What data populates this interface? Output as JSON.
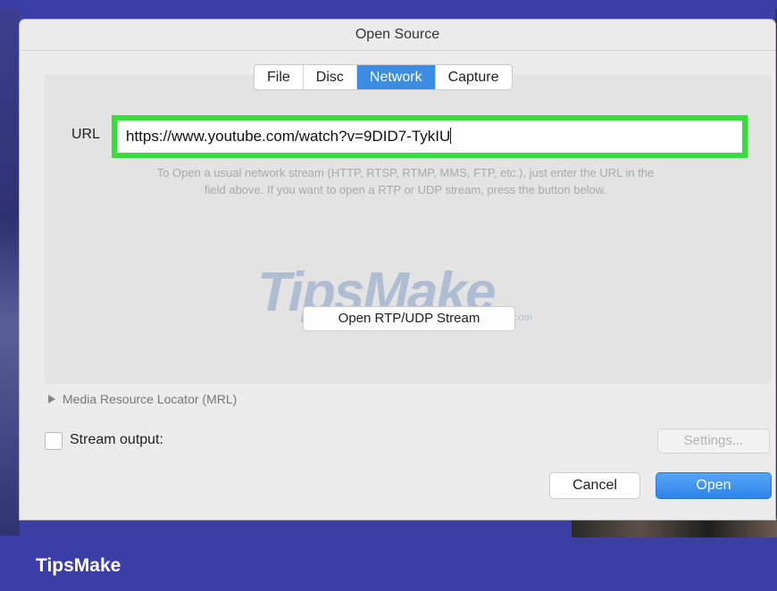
{
  "window": {
    "title": "Open Source"
  },
  "tabs": [
    {
      "label": "File",
      "active": false
    },
    {
      "label": "Disc",
      "active": false
    },
    {
      "label": "Network",
      "active": true
    },
    {
      "label": "Capture",
      "active": false
    }
  ],
  "network": {
    "url_label": "URL",
    "url_value": "https://www.youtube.com/watch?v=9DID7-TykIU",
    "hint_line1": "To Open a usual network stream (HTTP, RTSP, RTMP, MMS, FTP, etc.), just enter the URL in the",
    "hint_line2": "field above. If you want to open a RTP or UDP stream, press the button below.",
    "rtp_button": "Open RTP/UDP Stream"
  },
  "mrl": {
    "label": "Media Resource Locator (MRL)",
    "icon": "disclosure-triangle-icon"
  },
  "stream_output": {
    "label": "Stream output:",
    "checked": false,
    "settings_button": "Settings..."
  },
  "buttons": {
    "cancel": "Cancel",
    "open": "Open"
  },
  "watermark": {
    "text": "TipsMake",
    "suffix": ".com"
  },
  "footer": {
    "brand": "TipsMake"
  },
  "colors": {
    "accent": "#3b8de3",
    "highlight": "#33e038",
    "brand_bar": "#3a3ea6"
  }
}
